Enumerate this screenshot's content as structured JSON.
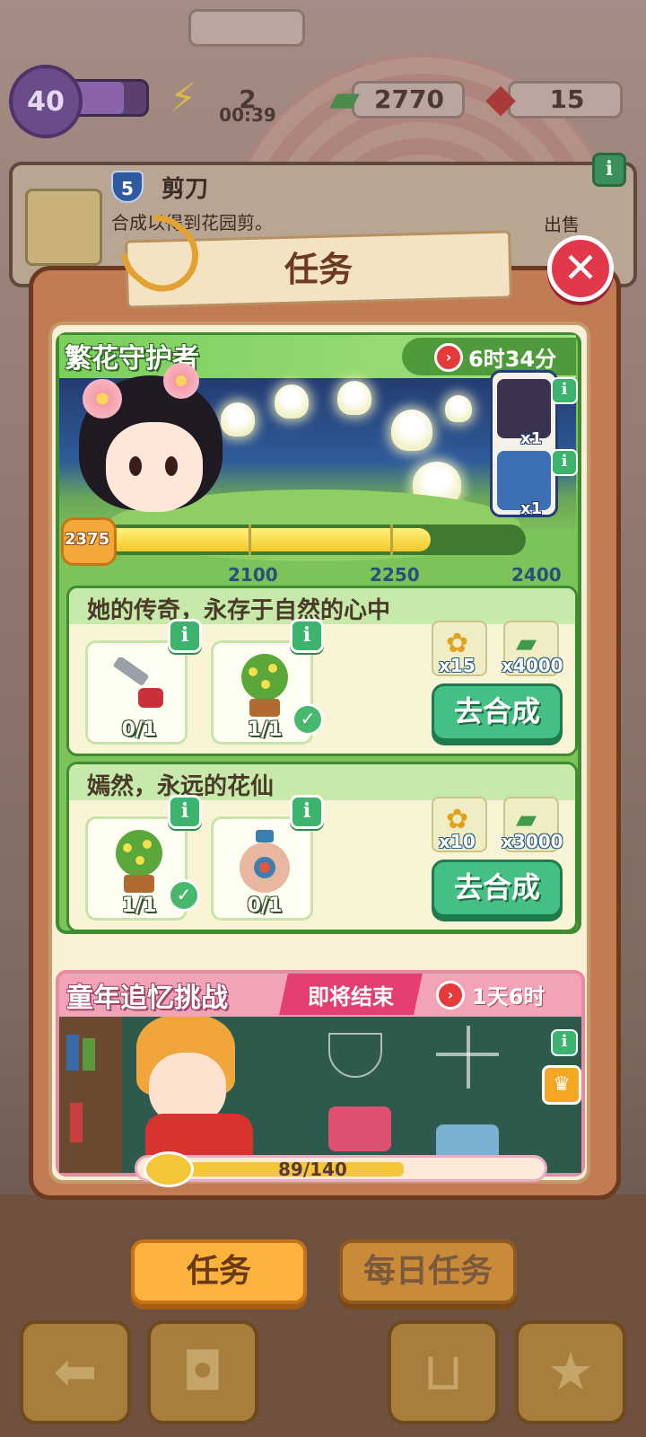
{
  "hud": {
    "level": "40",
    "energy": "2",
    "energy_timer": "00:39",
    "cash": "2770",
    "gems": "15"
  },
  "info_card": {
    "item_level": "5",
    "item_name": "剪刀",
    "description": "合成以得到花园剪。",
    "sell_label": "出售"
  },
  "panel": {
    "title": "任务"
  },
  "event1": {
    "title": "繁花守护者",
    "timer": "6时34分",
    "reward_counts": [
      "x1",
      "x1"
    ],
    "score": "2375",
    "progress": {
      "current": 2375,
      "min": 2000,
      "max": 2450
    },
    "milestones": [
      "2100",
      "2250",
      "2400"
    ],
    "tasks": [
      {
        "title": "她的传奇，永存于自然的心中",
        "items": [
          {
            "icon": "saw-icon",
            "count": "0/1",
            "done": false
          },
          {
            "icon": "flower-bush-icon",
            "count": "1/1",
            "done": true
          }
        ],
        "rewards": [
          {
            "icon": "gold-rose-icon",
            "amount": "x15"
          },
          {
            "icon": "cash-stack-icon",
            "amount": "x4000"
          }
        ],
        "button": "去合成"
      },
      {
        "title": "嫣然，永远的花仙",
        "items": [
          {
            "icon": "flower-bush-icon",
            "count": "1/1",
            "done": true
          },
          {
            "icon": "vase-icon",
            "count": "0/1",
            "done": false
          }
        ],
        "rewards": [
          {
            "icon": "gold-rose-icon",
            "amount": "x10"
          },
          {
            "icon": "cash-stack-icon",
            "amount": "x3000"
          }
        ],
        "button": "去合成"
      }
    ]
  },
  "event2": {
    "title": "童年追忆挑战",
    "status": "即将结束",
    "timer": "1天6时",
    "progress_text": "89/140",
    "progress": {
      "current": 89,
      "max": 140
    }
  },
  "tabs": {
    "active": "任务",
    "inactive": "每日任务"
  },
  "bottom_bar": [
    "back-arrow-icon",
    "backpack-icon",
    "basket-icon",
    "clipboard-star-icon"
  ],
  "colors": {
    "panel": "#c27b53",
    "event_green": "#7cc45a",
    "event_pink": "#f3a3b6",
    "button_green": "#45c084",
    "tab_active": "#fbb33d"
  }
}
